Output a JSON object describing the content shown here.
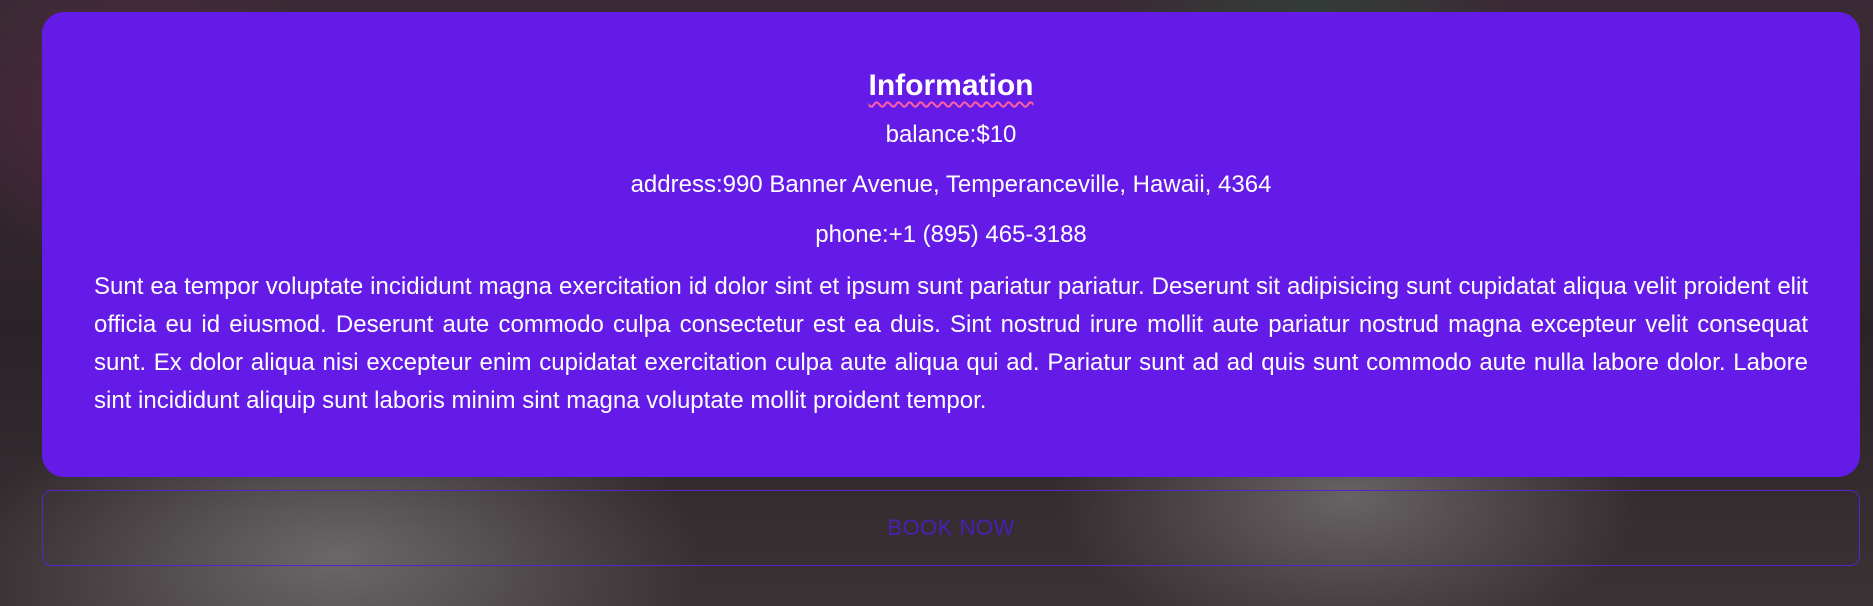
{
  "info": {
    "title": "Information",
    "balance": "balance:$10",
    "address": "address:990 Banner Avenue, Temperanceville, Hawaii, 4364",
    "phone": "phone:+1 (895) 465-3188",
    "description": "Sunt ea tempor voluptate incididunt magna exercitation id dolor sint et ipsum sunt pariatur pariatur. Deserunt sit adipisicing sunt cupidatat aliqua velit proident elit officia eu id eiusmod. Deserunt aute commodo culpa consectetur est ea duis. Sint nostrud irure mollit aute pariatur nostrud magna excepteur velit consequat sunt. Ex dolor aliqua nisi excepteur enim cupidatat exercitation culpa aute aliqua qui ad. Pariatur sunt ad ad quis sunt commodo aute nulla labore dolor. Labore sint incididunt aliquip sunt laboris minim sint magna voluptate mollit proident tempor."
  },
  "actions": {
    "book_label": "BOOK NOW"
  },
  "colors": {
    "card_background": "#651be8",
    "card_text": "#ffffff",
    "button_border": "#5a22c9",
    "button_text": "#4a1fb5",
    "title_underline": "#ff5fa2"
  }
}
